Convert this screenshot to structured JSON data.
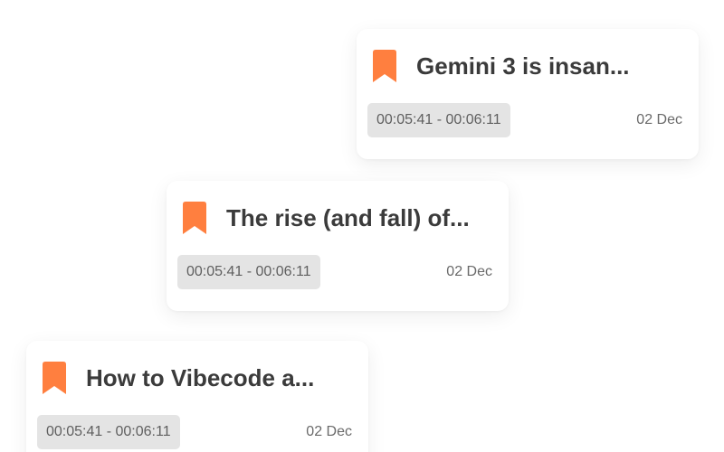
{
  "accent_color": "#ff7f3f",
  "cards": [
    {
      "icon": "bookmark-icon",
      "title": "Gemini 3 is insan...",
      "time_range": "00:05:41 - 00:06:11",
      "date": "02 Dec"
    },
    {
      "icon": "bookmark-icon",
      "title": "The rise (and fall) of...",
      "time_range": "00:05:41 - 00:06:11",
      "date": "02 Dec"
    },
    {
      "icon": "bookmark-icon",
      "title": "How to Vibecode a...",
      "time_range": "00:05:41 - 00:06:11",
      "date": "02 Dec"
    }
  ]
}
